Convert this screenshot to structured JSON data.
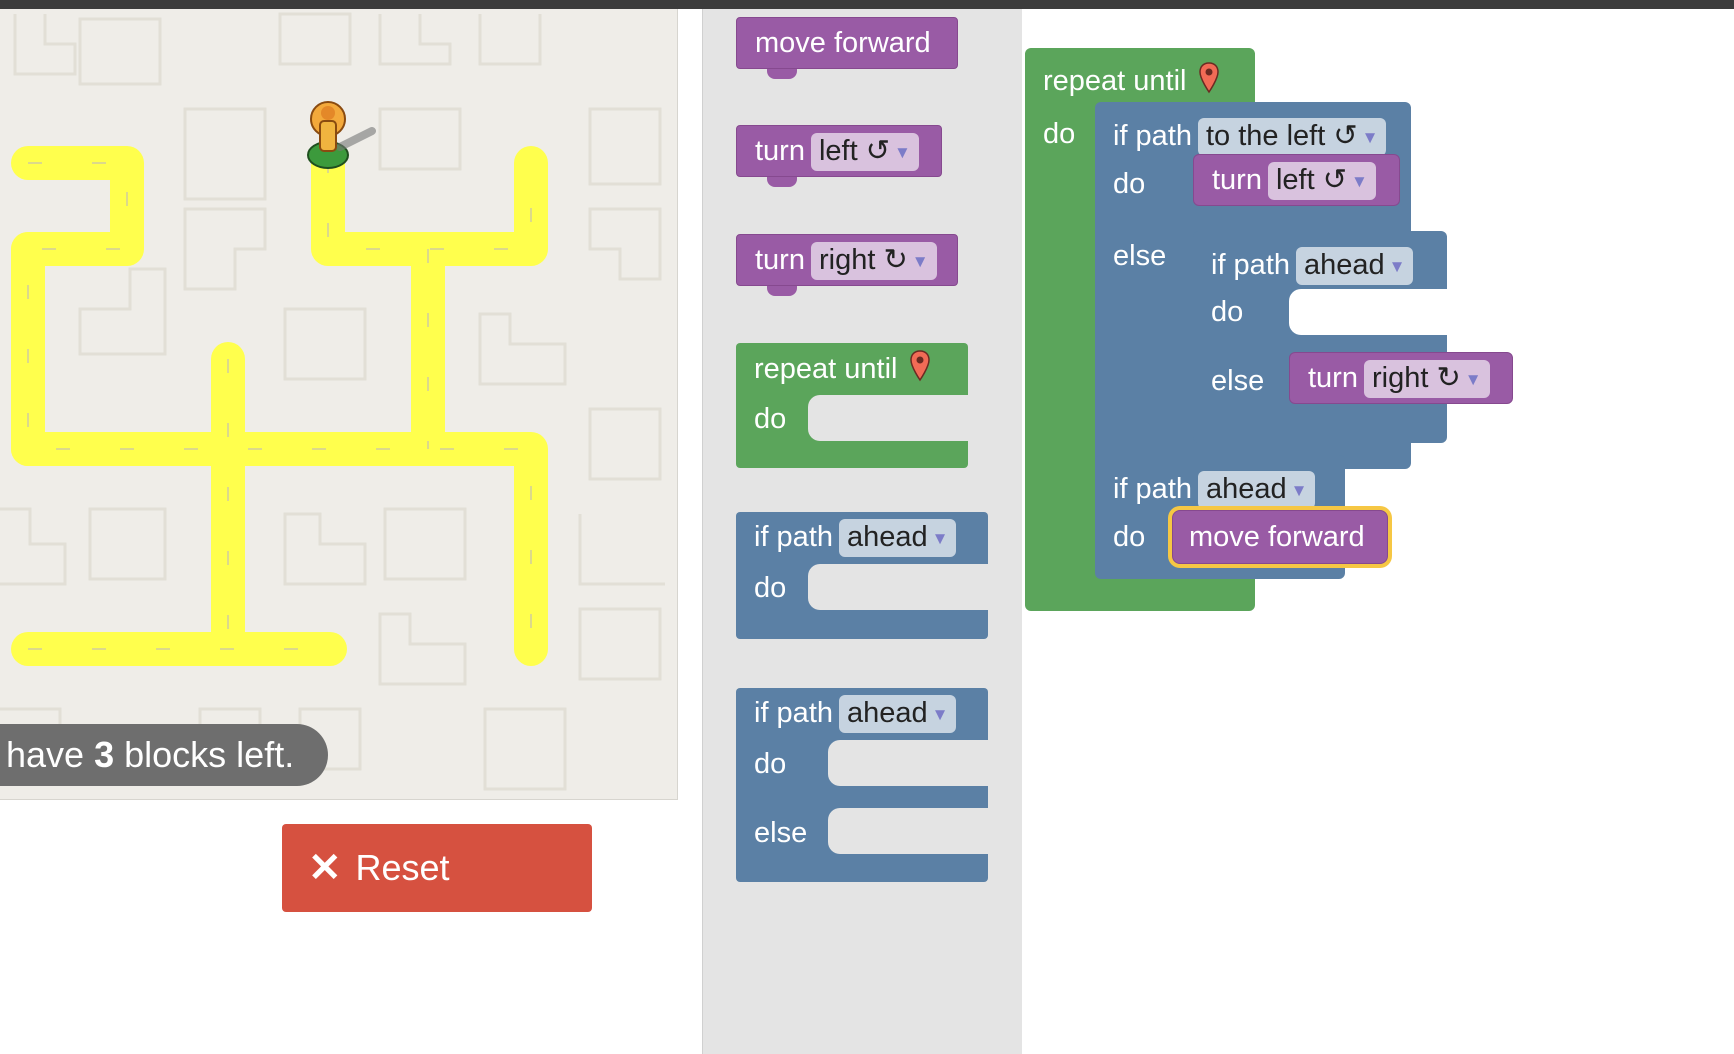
{
  "status": {
    "prefix": "have",
    "count": "3",
    "suffix": "blocks left."
  },
  "reset_button": {
    "label": "Reset",
    "icon": "close-icon"
  },
  "toolbox": {
    "move_forward": "move forward",
    "turn_left": {
      "label": "turn",
      "option": "left ↺"
    },
    "turn_right": {
      "label": "turn",
      "option": "right ↻"
    },
    "repeat_until": {
      "label": "repeat until",
      "do": "do",
      "icon": "map-pin-icon"
    },
    "if_path": {
      "label": "if path",
      "option": "ahead",
      "do": "do"
    },
    "if_else_path": {
      "label": "if path",
      "option": "ahead",
      "do": "do",
      "else": "else"
    }
  },
  "program": {
    "repeat_label": "repeat until",
    "repeat_do": "do",
    "if1": {
      "label": "if path",
      "option": "to the left ↺",
      "do": "do",
      "else": "else"
    },
    "turn_left": {
      "label": "turn",
      "option": "left ↺"
    },
    "if2": {
      "label": "if path",
      "option": "ahead",
      "do": "do",
      "else": "else"
    },
    "turn_right": {
      "label": "turn",
      "option": "right ↻"
    },
    "if3": {
      "label": "if path",
      "option": "ahead",
      "do": "do"
    },
    "move_forward": "move forward"
  },
  "colors": {
    "motion": "#995ba5",
    "loop": "#5ba55b",
    "logic": "#5b80a5",
    "path": "#ffff4d",
    "reset": "#d65140"
  }
}
